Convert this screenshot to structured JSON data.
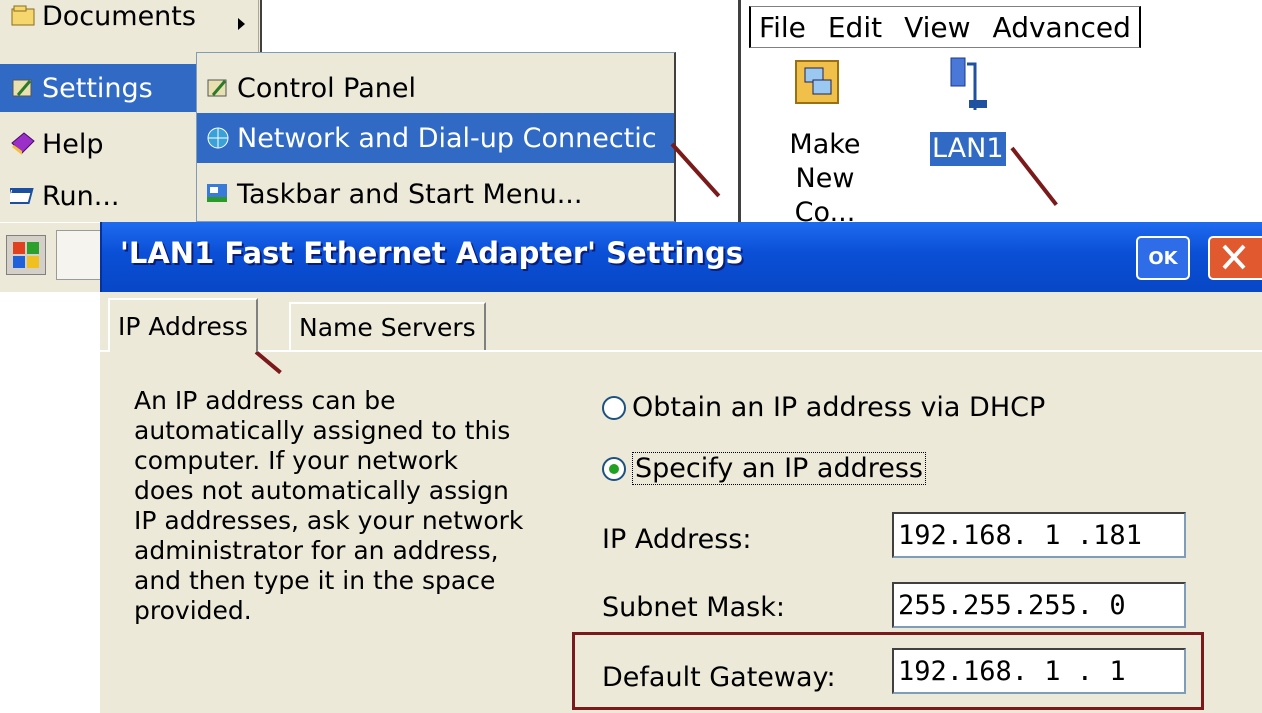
{
  "start_menu": {
    "items": [
      {
        "label": "Documents"
      },
      {
        "label": "Settings"
      },
      {
        "label": "Help"
      },
      {
        "label": "Run..."
      }
    ],
    "submenu": [
      {
        "label": "Control Panel"
      },
      {
        "label": "Network and Dial-up Connectic"
      },
      {
        "label": "Taskbar and Start Menu..."
      }
    ]
  },
  "explorer": {
    "menu": [
      "File",
      "Edit",
      "View",
      "Advanced"
    ],
    "icons": [
      {
        "label_line1": "Make",
        "label_line2": "New Co..."
      },
      {
        "label": "LAN1"
      }
    ]
  },
  "dialog": {
    "title": "'LAN1 Fast Ethernet Adapter' Settings",
    "ok_label": "OK",
    "tabs": [
      "IP Address",
      "Name Servers"
    ],
    "description": "An IP address can be\nautomatically assigned to this\ncomputer.  If your network\ndoes not automatically assign\nIP addresses, ask your network\nadministrator for an address,\nand then type it in the space\nprovided.",
    "radio_dhcp": "Obtain an IP address via DHCP",
    "radio_specify": "Specify an IP address",
    "fields": {
      "ip_label": "IP Address:",
      "ip_value": "192.168. 1 .181",
      "mask_label": "Subnet Mask:",
      "mask_value": "255.255.255. 0",
      "gateway_label": "Default Gateway:",
      "gateway_value": "192.168. 1 . 1"
    }
  },
  "colors": {
    "highlight": "#316ac5",
    "titlebar": "#0a4fd6",
    "annotation": "#7a1a1a"
  }
}
